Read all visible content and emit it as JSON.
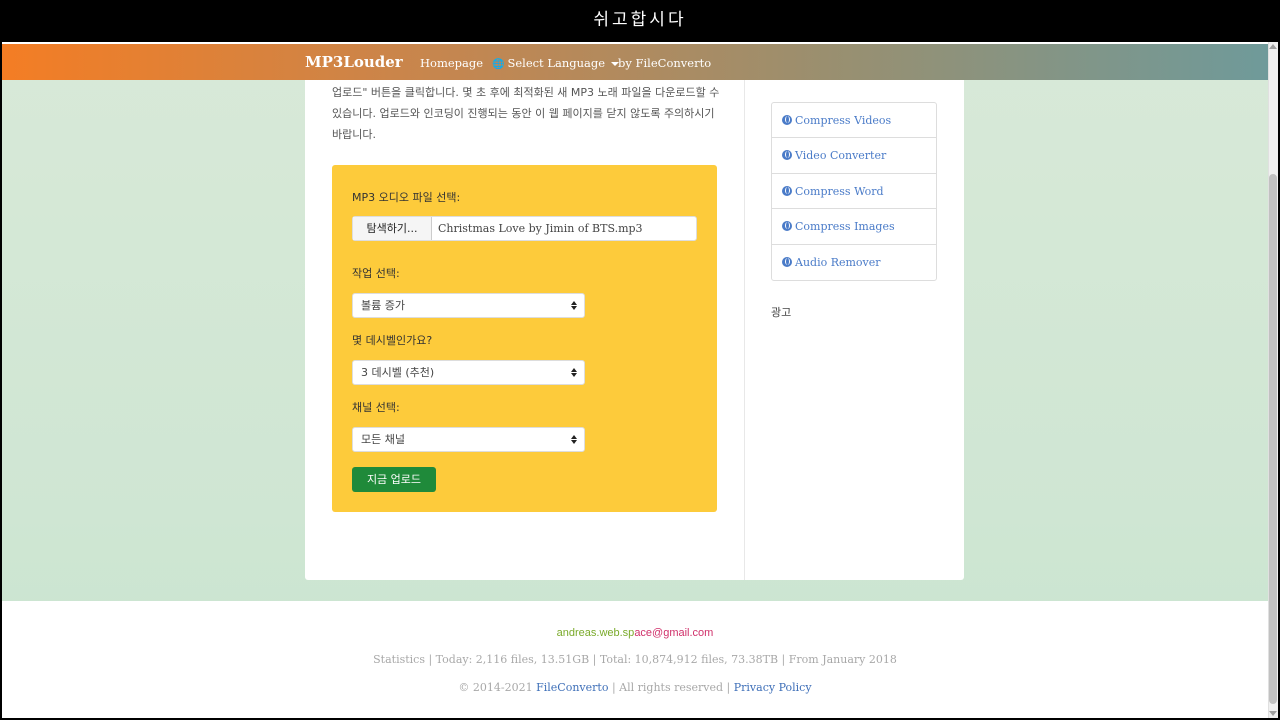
{
  "banner": {
    "title": "쉬고합시다"
  },
  "nav": {
    "brand": "MP3Louder",
    "homepage": "Homepage",
    "select_language": "Select Language",
    "by": "by FileConverto"
  },
  "intro": {
    "text": "업로드\" 버튼을 클릭합니다. 몇 초 후에 최적화된 새 MP3 노래 파일을 다운로드할 수 있습니다. 업로드와 인코딩이 진행되는 동안 이 웹 페이지를 닫지 않도록 주의하시기 바랍니다."
  },
  "form": {
    "file_label": "MP3 오디오 파일 선택:",
    "browse_label": "탐색하기...",
    "file_name": "Christmas Love by Jimin of BTS.mp3",
    "task_label": "작업 선택:",
    "task_value": "볼륨 증가",
    "db_label": "몇 데시벨인가요?",
    "db_value": "3 데시벨 (추천)",
    "channel_label": "채널 선택:",
    "channel_value": "모든 채널",
    "upload_label": "지금 업로드"
  },
  "sidebar": {
    "items": [
      {
        "label": "Compress Videos"
      },
      {
        "label": "Video Converter"
      },
      {
        "label": "Compress Word"
      },
      {
        "label": "Compress Images"
      },
      {
        "label": "Audio Remover"
      }
    ],
    "ad_label": "광고"
  },
  "footer": {
    "email_part1": "andreas.web.sp",
    "email_part2": "ace@gmail.com",
    "stats": "Statistics | Today: 2,116 files, 13.51GB | Total: 10,874,912 files, 73.38TB | From January 2018",
    "copyright_prefix": "© 2014-2021",
    "copyright_link": "FileConverto",
    "copyright_mid": "| All rights reserved |",
    "privacy": "Privacy Policy"
  },
  "colors": {
    "accent_green": "#1f8a3a",
    "form_yellow": "#fdcb3b",
    "link_blue": "#4a7bc8",
    "nav_start": "#f47d24",
    "nav_end": "#6f9a9a"
  }
}
